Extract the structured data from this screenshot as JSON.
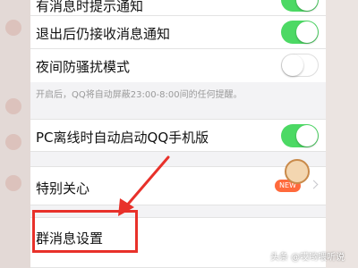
{
  "settings": {
    "top_partial_label": "有消息时提示通知",
    "exit_receive_label": "退出后仍接收消息通知",
    "night_mode_label": "夜间防骚扰模式",
    "night_mode_hint": "开启后，QQ将自动屏蔽23:00-8:00间的任何提醒。",
    "pc_offline_label": "PC离线时自动启动QQ手机版",
    "special_care_label": "特别关心",
    "special_care_badge": "NEW",
    "group_settings_label": "群消息设置"
  },
  "toggles": {
    "top_partial": true,
    "exit_receive": true,
    "night_mode": false,
    "pc_offline": true
  },
  "colors": {
    "switch_on": "#4cd964",
    "highlight": "#e8312a",
    "badge": "#ff6a3c"
  },
  "watermark": "头条 @哎哟喂听说"
}
